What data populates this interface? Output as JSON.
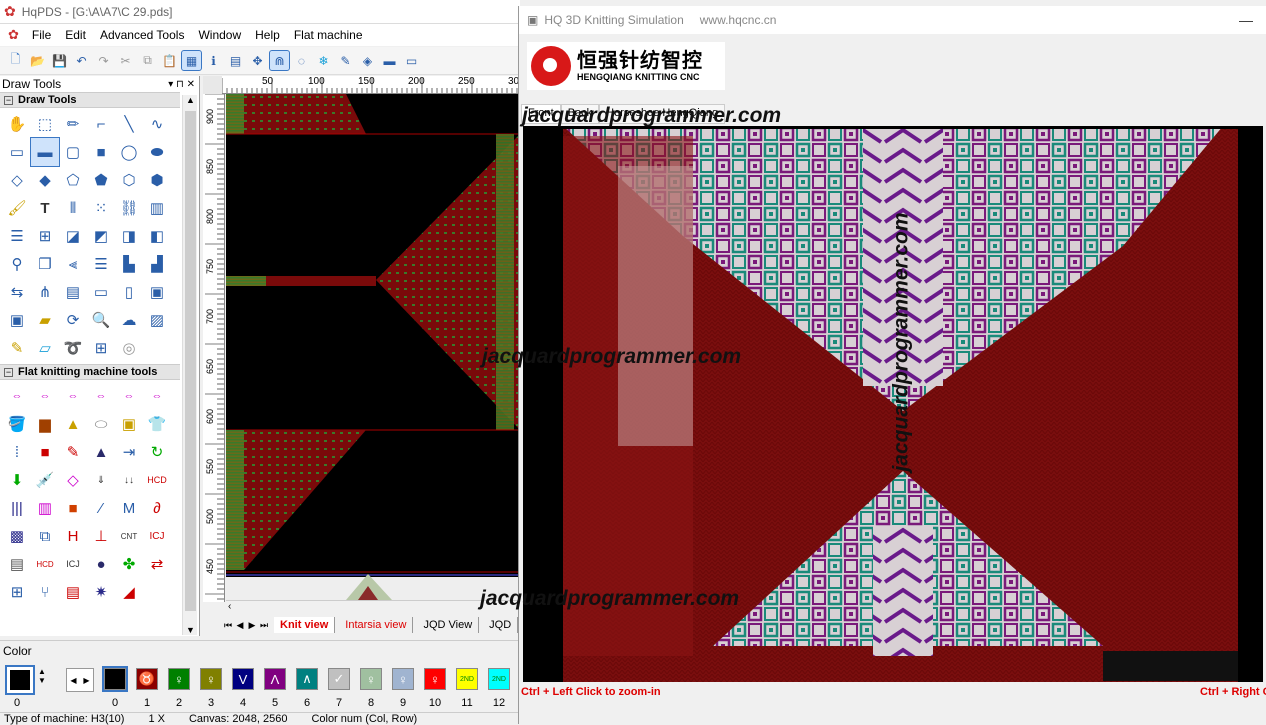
{
  "main_window": {
    "title": "HqPDS - [G:\\A\\A7\\C 29.pds]",
    "menu": [
      "File",
      "Edit",
      "Advanced Tools",
      "Window",
      "Help",
      "Flat machine"
    ]
  },
  "draw_tools_panel": {
    "header": "Draw Tools",
    "section1": "Draw Tools",
    "section2": "Flat knitting machine tools"
  },
  "ruler": {
    "top_ticks": [
      "50",
      "100",
      "150",
      "200",
      "250",
      "30"
    ],
    "left_ticks": [
      "900",
      "850",
      "800",
      "750",
      "700",
      "650",
      "600",
      "550",
      "500",
      "450"
    ]
  },
  "view_tabs": [
    "Knit view",
    "Intarsia view",
    "JQD View",
    "JQD"
  ],
  "color_panel": {
    "label": "Color",
    "current_index": "0",
    "swatches": [
      {
        "num": "0",
        "color": "#000000",
        "glyph": ""
      },
      {
        "num": "1",
        "color": "#8b0000",
        "glyph": "♉"
      },
      {
        "num": "2",
        "color": "#008000",
        "glyph": "♀"
      },
      {
        "num": "3",
        "color": "#808000",
        "glyph": "♀"
      },
      {
        "num": "4",
        "color": "#000080",
        "glyph": "V"
      },
      {
        "num": "5",
        "color": "#800080",
        "glyph": "Λ"
      },
      {
        "num": "6",
        "color": "#008080",
        "glyph": "∧"
      },
      {
        "num": "7",
        "color": "#c0c0c0",
        "glyph": "✓"
      },
      {
        "num": "8",
        "color": "#a0c0a0",
        "glyph": "♀"
      },
      {
        "num": "9",
        "color": "#a0b4d0",
        "glyph": "♀"
      },
      {
        "num": "10",
        "color": "#ff0000",
        "glyph": "♀"
      },
      {
        "num": "11",
        "color": "#ffff00",
        "glyph": "2ND"
      },
      {
        "num": "12",
        "color": "#00ffff",
        "glyph": "2ND"
      }
    ]
  },
  "status_bar": {
    "machine": "Type of machine: H3(10)",
    "zoom": "1 X",
    "canvas": "Canvas: 2048, 2560",
    "colornum": "Color num (Col, Row)"
  },
  "sim_window": {
    "title": "HQ 3D Knitting Simulation",
    "url": "www.hqcnc.cn",
    "logo_cn": "恒强针纺智控",
    "logo_en": "HENGQIANG KNITTING CNC",
    "tabs": [
      "Front",
      "Back",
      "Horseshoe HengQiang"
    ],
    "hint_left": "Ctrl + Left Click to zoom-in",
    "hint_right": "Ctrl + Right Click to zoom-out"
  },
  "watermark": "jacquardprogrammer.com"
}
